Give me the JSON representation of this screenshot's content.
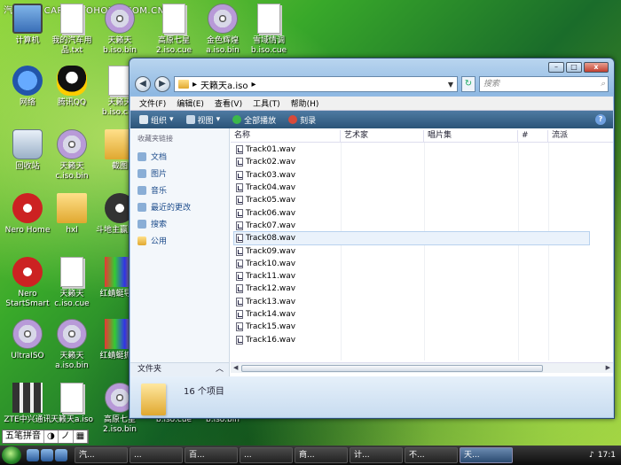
{
  "watermark": "汽车之家  CAR.AUTOHOME.COM.CN",
  "desktop": {
    "icons": [
      {
        "label": "计算机",
        "icon": "computer-icon"
      },
      {
        "label": "我的汽车用品.txt",
        "icon": "text-file-icon"
      },
      {
        "label": "天籁天b.iso.bin",
        "icon": "cd-image-icon"
      },
      {
        "label": "高原七星2.iso.cue",
        "icon": "cue-file-icon"
      },
      {
        "label": "金色辉煌a.iso.bin",
        "icon": "cd-image-icon"
      },
      {
        "label": "雪域情调b.iso.cue",
        "icon": "cue-file-icon"
      },
      {
        "label": "网络",
        "icon": "network-icon"
      },
      {
        "label": "腾讯QQ",
        "icon": "qq-icon"
      },
      {
        "label": "天籁天b.iso.cue",
        "icon": "cue-file-icon"
      },
      {
        "label": "回收站",
        "icon": "recycle-bin-icon"
      },
      {
        "label": "天籁天c.iso.bin",
        "icon": "cd-image-icon"
      },
      {
        "label": "截图",
        "icon": "folder-icon"
      },
      {
        "label": "Nero Home",
        "icon": "nero-home-icon"
      },
      {
        "label": "hxl",
        "icon": "folder-icon"
      },
      {
        "label": "斗地主赢家卡",
        "icon": "game-icon"
      },
      {
        "label": "Nero StartSmart",
        "icon": "nero-icon"
      },
      {
        "label": "天籁天c.iso.cue",
        "icon": "cue-file-icon"
      },
      {
        "label": "红蜻蜓导航",
        "icon": "app-icon"
      },
      {
        "label": "UltraISO",
        "icon": "ultraiso-icon"
      },
      {
        "label": "天籁天a.iso.bin",
        "icon": "cd-image-icon"
      },
      {
        "label": "红蜻蜓抓图",
        "icon": "app-icon"
      },
      {
        "label": "ZTE中兴通讯",
        "icon": "zte-icon"
      },
      {
        "label": "天籁天a.iso",
        "icon": "cue-file-icon"
      },
      {
        "label": "高原七星2.iso.bin",
        "icon": "cd-image-icon"
      },
      {
        "label": "b.iso.cue",
        "icon": "cue-file-icon"
      },
      {
        "label": "b.iso.bin",
        "icon": "cd-image-icon"
      }
    ]
  },
  "window": {
    "address": "天籁天a.iso",
    "search_placeholder": "搜索",
    "caption": {
      "minimize": "–",
      "maximize": "□",
      "close": "x"
    },
    "menu": [
      "文件(F)",
      "编辑(E)",
      "查看(V)",
      "工具(T)",
      "帮助(H)"
    ],
    "toolbar": {
      "organize": "组织",
      "views": "视图",
      "play_all": "全部播放",
      "burn": "刻录"
    },
    "nav": {
      "header": "收藏夹链接",
      "links": [
        {
          "label": "文档",
          "icon": "documents-icon"
        },
        {
          "label": "图片",
          "icon": "pictures-icon"
        },
        {
          "label": "音乐",
          "icon": "music-icon"
        },
        {
          "label": "最近的更改",
          "icon": "recent-icon"
        },
        {
          "label": "搜索",
          "icon": "search-icon"
        },
        {
          "label": "公用",
          "icon": "public-folder-icon"
        }
      ],
      "folders_label": "文件夹"
    },
    "columns": {
      "name": "名称",
      "artist": "艺术家",
      "album": "唱片集",
      "number": "#",
      "genre": "流派"
    },
    "files": [
      "Track01.wav",
      "Track02.wav",
      "Track03.wav",
      "Track04.wav",
      "Track05.wav",
      "Track06.wav",
      "Track07.wav",
      "Track08.wav",
      "Track09.wav",
      "Track10.wav",
      "Track11.wav",
      "Track12.wav",
      "Track13.wav",
      "Track14.wav",
      "Track15.wav",
      "Track16.wav"
    ],
    "selected_file": "Track08.wav",
    "status": "16 个项目"
  },
  "taskbar": {
    "ime": [
      "五笔拼音",
      "◑",
      "ノ",
      "▦"
    ],
    "tasks": [
      "汽...",
      "...",
      "百...",
      "...",
      "商...",
      "计...",
      "不...",
      "天..."
    ],
    "active_task": "天...",
    "clock": "17:1"
  },
  "colors": {
    "selection": "#eaf2fb",
    "toolbar": "#2b5478",
    "link": "#1a4a8a"
  }
}
